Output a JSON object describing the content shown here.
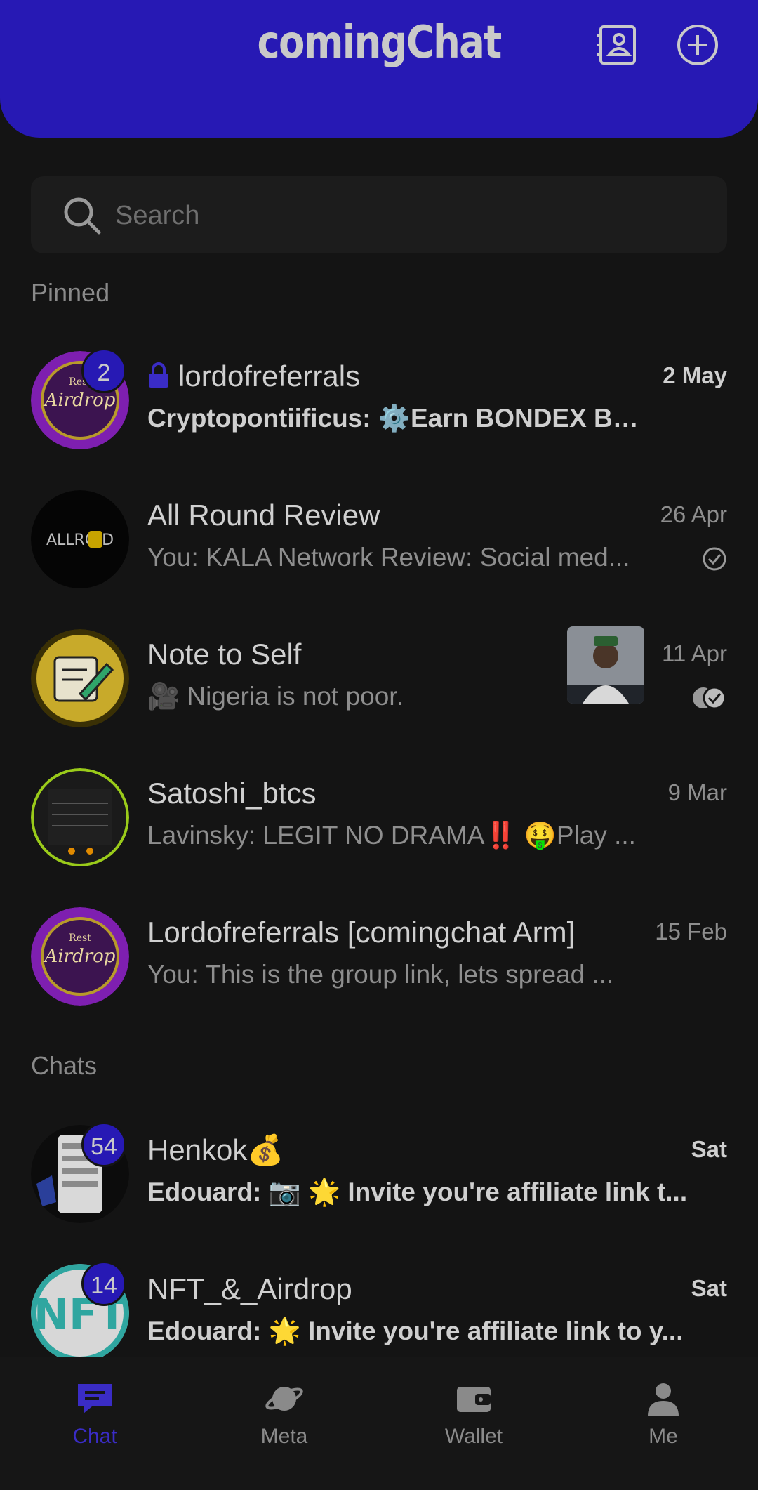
{
  "app": {
    "title": "comingChat"
  },
  "header": {
    "contacts_icon": "contacts-card-icon",
    "add_icon": "plus-circle-icon"
  },
  "search": {
    "placeholder": "Search"
  },
  "sections": {
    "pinned": "Pinned",
    "chats": "Chats"
  },
  "pinned": [
    {
      "name": "lordofreferrals",
      "locked": true,
      "preview_sender": "Cryptopontiificus:",
      "preview_text": " ⚙️Earn BONDEX BN...",
      "time": "2 May",
      "badge": "2",
      "bold": true
    },
    {
      "name": "All Round Review",
      "preview_sender": "You:",
      "preview_text": " KALA Network Review: Social med...",
      "time": "26 Apr",
      "status": "sent-check"
    },
    {
      "name": "Note to Self",
      "preview_sender": "",
      "preview_text": "🎥 Nigeria is not poor.",
      "time": "11 Apr",
      "status": "read-double-check"
    },
    {
      "name": "Satoshi_btcs",
      "preview_sender": "Lavinsky:",
      "preview_text": " LEGIT NO DRAMA‼️  🤑Play ...",
      "time": "9 Mar"
    },
    {
      "name": "Lordofreferrals [comingchat Arm]",
      "preview_sender": "You:",
      "preview_text": " This is the group link, lets spread ...",
      "time": "15 Feb"
    }
  ],
  "chats": [
    {
      "name": "Henkok💰",
      "preview_sender": "Edouard:",
      "preview_text": " 📷 🌟 Invite you're affiliate link t...",
      "time": "Sat",
      "badge": "54",
      "bold": true
    },
    {
      "name": "NFT_&_Airdrop",
      "preview_sender": "Edouard:",
      "preview_text": " 🌟 Invite you're affiliate link to y...",
      "time": "Sat",
      "badge": "14",
      "bold": true
    }
  ],
  "nav": [
    {
      "label": "Chat",
      "icon": "chat-bubble-icon",
      "active": true
    },
    {
      "label": "Meta",
      "icon": "planet-icon"
    },
    {
      "label": "Wallet",
      "icon": "wallet-icon"
    },
    {
      "label": "Me",
      "icon": "person-icon"
    }
  ],
  "colors": {
    "accent": "#2719b4",
    "background": "#141414",
    "text": "#cfcfcf",
    "muted": "#8e8e8e"
  }
}
